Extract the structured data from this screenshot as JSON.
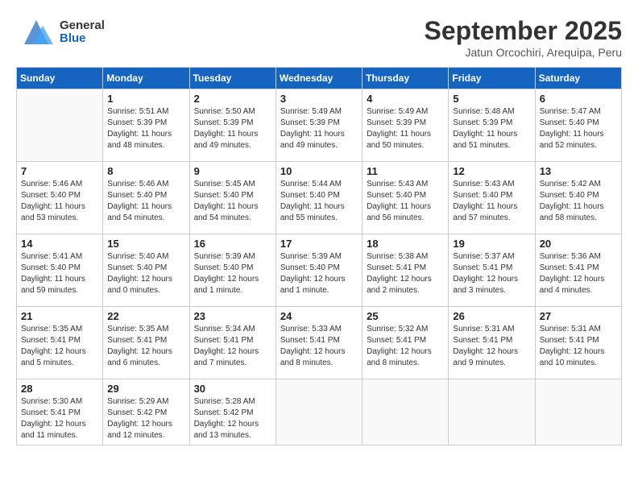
{
  "header": {
    "logo_general": "General",
    "logo_blue": "Blue",
    "month_title": "September 2025",
    "location": "Jatun Orcochiri, Arequipa, Peru"
  },
  "days_of_week": [
    "Sunday",
    "Monday",
    "Tuesday",
    "Wednesday",
    "Thursday",
    "Friday",
    "Saturday"
  ],
  "weeks": [
    [
      {
        "day": "",
        "info": ""
      },
      {
        "day": "1",
        "info": "Sunrise: 5:51 AM\nSunset: 5:39 PM\nDaylight: 11 hours\nand 48 minutes."
      },
      {
        "day": "2",
        "info": "Sunrise: 5:50 AM\nSunset: 5:39 PM\nDaylight: 11 hours\nand 49 minutes."
      },
      {
        "day": "3",
        "info": "Sunrise: 5:49 AM\nSunset: 5:39 PM\nDaylight: 11 hours\nand 49 minutes."
      },
      {
        "day": "4",
        "info": "Sunrise: 5:49 AM\nSunset: 5:39 PM\nDaylight: 11 hours\nand 50 minutes."
      },
      {
        "day": "5",
        "info": "Sunrise: 5:48 AM\nSunset: 5:39 PM\nDaylight: 11 hours\nand 51 minutes."
      },
      {
        "day": "6",
        "info": "Sunrise: 5:47 AM\nSunset: 5:40 PM\nDaylight: 11 hours\nand 52 minutes."
      }
    ],
    [
      {
        "day": "7",
        "info": "Sunrise: 5:46 AM\nSunset: 5:40 PM\nDaylight: 11 hours\nand 53 minutes."
      },
      {
        "day": "8",
        "info": "Sunrise: 5:46 AM\nSunset: 5:40 PM\nDaylight: 11 hours\nand 54 minutes."
      },
      {
        "day": "9",
        "info": "Sunrise: 5:45 AM\nSunset: 5:40 PM\nDaylight: 11 hours\nand 54 minutes."
      },
      {
        "day": "10",
        "info": "Sunrise: 5:44 AM\nSunset: 5:40 PM\nDaylight: 11 hours\nand 55 minutes."
      },
      {
        "day": "11",
        "info": "Sunrise: 5:43 AM\nSunset: 5:40 PM\nDaylight: 11 hours\nand 56 minutes."
      },
      {
        "day": "12",
        "info": "Sunrise: 5:43 AM\nSunset: 5:40 PM\nDaylight: 11 hours\nand 57 minutes."
      },
      {
        "day": "13",
        "info": "Sunrise: 5:42 AM\nSunset: 5:40 PM\nDaylight: 11 hours\nand 58 minutes."
      }
    ],
    [
      {
        "day": "14",
        "info": "Sunrise: 5:41 AM\nSunset: 5:40 PM\nDaylight: 11 hours\nand 59 minutes."
      },
      {
        "day": "15",
        "info": "Sunrise: 5:40 AM\nSunset: 5:40 PM\nDaylight: 12 hours\nand 0 minutes."
      },
      {
        "day": "16",
        "info": "Sunrise: 5:39 AM\nSunset: 5:40 PM\nDaylight: 12 hours\nand 1 minute."
      },
      {
        "day": "17",
        "info": "Sunrise: 5:39 AM\nSunset: 5:40 PM\nDaylight: 12 hours\nand 1 minute."
      },
      {
        "day": "18",
        "info": "Sunrise: 5:38 AM\nSunset: 5:41 PM\nDaylight: 12 hours\nand 2 minutes."
      },
      {
        "day": "19",
        "info": "Sunrise: 5:37 AM\nSunset: 5:41 PM\nDaylight: 12 hours\nand 3 minutes."
      },
      {
        "day": "20",
        "info": "Sunrise: 5:36 AM\nSunset: 5:41 PM\nDaylight: 12 hours\nand 4 minutes."
      }
    ],
    [
      {
        "day": "21",
        "info": "Sunrise: 5:35 AM\nSunset: 5:41 PM\nDaylight: 12 hours\nand 5 minutes."
      },
      {
        "day": "22",
        "info": "Sunrise: 5:35 AM\nSunset: 5:41 PM\nDaylight: 12 hours\nand 6 minutes."
      },
      {
        "day": "23",
        "info": "Sunrise: 5:34 AM\nSunset: 5:41 PM\nDaylight: 12 hours\nand 7 minutes."
      },
      {
        "day": "24",
        "info": "Sunrise: 5:33 AM\nSunset: 5:41 PM\nDaylight: 12 hours\nand 8 minutes."
      },
      {
        "day": "25",
        "info": "Sunrise: 5:32 AM\nSunset: 5:41 PM\nDaylight: 12 hours\nand 8 minutes."
      },
      {
        "day": "26",
        "info": "Sunrise: 5:31 AM\nSunset: 5:41 PM\nDaylight: 12 hours\nand 9 minutes."
      },
      {
        "day": "27",
        "info": "Sunrise: 5:31 AM\nSunset: 5:41 PM\nDaylight: 12 hours\nand 10 minutes."
      }
    ],
    [
      {
        "day": "28",
        "info": "Sunrise: 5:30 AM\nSunset: 5:41 PM\nDaylight: 12 hours\nand 11 minutes."
      },
      {
        "day": "29",
        "info": "Sunrise: 5:29 AM\nSunset: 5:42 PM\nDaylight: 12 hours\nand 12 minutes."
      },
      {
        "day": "30",
        "info": "Sunrise: 5:28 AM\nSunset: 5:42 PM\nDaylight: 12 hours\nand 13 minutes."
      },
      {
        "day": "",
        "info": ""
      },
      {
        "day": "",
        "info": ""
      },
      {
        "day": "",
        "info": ""
      },
      {
        "day": "",
        "info": ""
      }
    ]
  ]
}
